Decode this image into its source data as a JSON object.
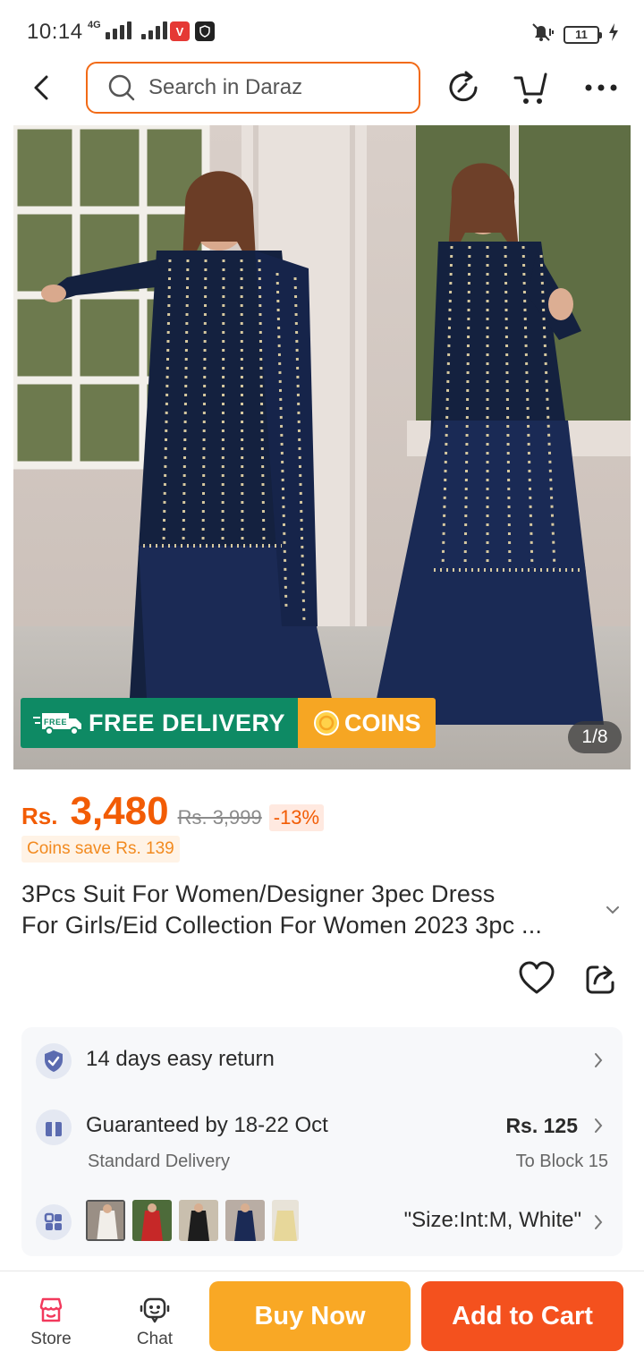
{
  "status_bar": {
    "time": "10:14",
    "network": "4G",
    "battery": "11"
  },
  "search": {
    "placeholder": "Search in Daraz"
  },
  "hero": {
    "page_indicator": "1/8",
    "free_delivery": "FREE DELIVERY",
    "free_tag": "FREE",
    "coins": "COINS"
  },
  "price": {
    "currency": "Rs.",
    "current": "3,480",
    "original": "Rs. 3,999",
    "discount": "-13%",
    "coins_save": "Coins save Rs. 139"
  },
  "product": {
    "title_line1": "3Pcs Suit For Women/Designer 3pec  Dress",
    "title_line2": "For Girls/Eid Collection For Women 2023 3pc ..."
  },
  "services": {
    "return": "14 days easy return",
    "delivery_title": "Guaranteed by 18-22 Oct",
    "delivery_sub": "Standard Delivery",
    "delivery_price": "Rs. 125",
    "delivery_location": "To Block 15",
    "variant": "\"Size:Int:M, White\""
  },
  "bottom_nav": {
    "store": "Store",
    "chat": "Chat",
    "buy_now": "Buy Now",
    "add_to_cart": "Add to Cart"
  },
  "colors": {
    "accent_orange": "#f25c05",
    "buy_now": "#f9a825",
    "add_to_cart": "#f4511e",
    "free_delivery": "#0e8a64",
    "coins": "#f6a623"
  }
}
